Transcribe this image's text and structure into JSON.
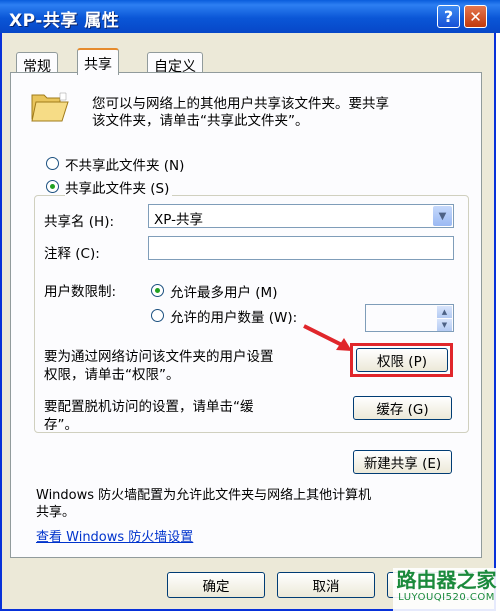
{
  "window": {
    "title": "XP-共享 属性",
    "help_glyph": "?",
    "close_glyph": "✕"
  },
  "tabs": [
    {
      "label": "常规"
    },
    {
      "label": "共享"
    },
    {
      "label": "自定义"
    }
  ],
  "intro": {
    "line1": "您可以与网络上的其他用户共享该文件夹。要共享",
    "line2": "该文件夹，请单击“共享此文件夹”。"
  },
  "options": {
    "no_share": "不共享此文件夹 (N)",
    "share": "共享此文件夹 (S)"
  },
  "share_name": {
    "label": "共享名 (H):",
    "value": "XP-共享"
  },
  "comment": {
    "label": "注释 (C):",
    "value": ""
  },
  "user_limit": {
    "label": "用户数限制:",
    "max_allowed": "允许最多用户 (M)",
    "allowed_count": "允许的用户数量 (W):"
  },
  "permissions": {
    "desc_line1": "要为通过网络访问该文件夹的用户设置",
    "desc_line2": "权限，请单击“权限”。",
    "button": "权限 (P)"
  },
  "caching": {
    "desc_line1": "要配置脱机访问的设置，请单击“缓",
    "desc_line2": "存”。",
    "button": "缓存 (G)"
  },
  "new_share": {
    "button": "新建共享 (E)"
  },
  "firewall": {
    "line1": "Windows 防火墙配置为允许此文件夹与网络上其他计算机",
    "line2": "共享。",
    "link": "查看 Windows 防火墙设置"
  },
  "footer": {
    "ok": "确定",
    "cancel": "取消"
  },
  "watermark": {
    "name": "路由器之家",
    "url": "LUYOUQI520.COM"
  },
  "colors": {
    "accent": "#e0262b",
    "title_blue": "#0a56d6",
    "link": "#0033cc",
    "watermark_green": "#1b8a3c"
  }
}
